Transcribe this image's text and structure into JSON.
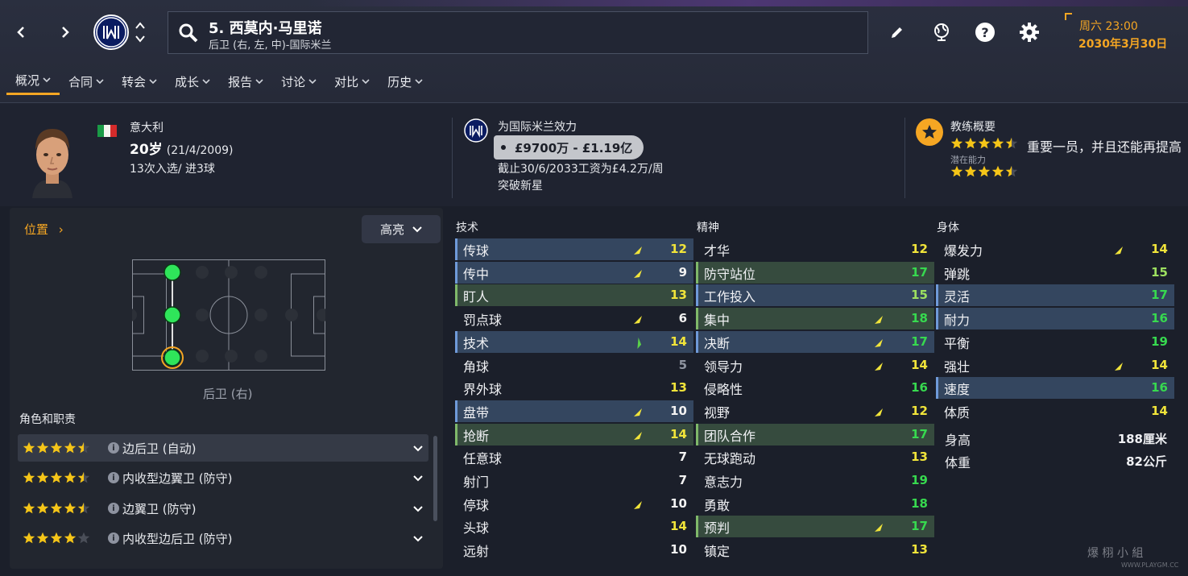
{
  "header": {
    "player_title": "5. 西莫内·马里诺",
    "player_position": "后卫 (右, 左, 中)-国际米兰",
    "club_badge_text": "M",
    "date_line1": "周六 23:00",
    "date_line2": "2030年3月30日"
  },
  "tabs": [
    {
      "label": "概况",
      "active": true
    },
    {
      "label": "合同"
    },
    {
      "label": "转会"
    },
    {
      "label": "成长"
    },
    {
      "label": "报告"
    },
    {
      "label": "讨论"
    },
    {
      "label": "对比"
    },
    {
      "label": "历史"
    }
  ],
  "profile": {
    "nationality": "意大利",
    "age": "20岁",
    "birthdate": "(21/4/2009)",
    "caps": "13次入选/ 进3球",
    "club_line": "为国际米兰效力",
    "value_range": "£9700万 - £1.19亿",
    "contract": "截止30/6/2033工资为£4.2万/周",
    "status": "突破新星",
    "coach_title": "教练概要",
    "coach_summary": "重要一员，并且还能再提高",
    "potential_label": "潜在能力",
    "current_stars": 4.5,
    "potential_stars": 4.5
  },
  "left_panel": {
    "position_link": "位置",
    "highlight_button": "高亮",
    "position_label": "后卫 (右)",
    "roles_title": "角色和职责",
    "roles": [
      {
        "stars": 4.5,
        "label": "边后卫 (自动)"
      },
      {
        "stars": 4.5,
        "label": "内收型边翼卫 (防守)"
      },
      {
        "stars": 4.5,
        "label": "边翼卫 (防守)"
      },
      {
        "stars": 4.0,
        "label": "内收型边后卫 (防守)"
      }
    ]
  },
  "columns": {
    "technical": {
      "title": "技术",
      "attrs": [
        {
          "name": "传球",
          "value": "12",
          "color": "yellow",
          "hl": "blue",
          "arrow": "up"
        },
        {
          "name": "传中",
          "value": "9",
          "color": "white",
          "hl": "blue",
          "arrow": "up"
        },
        {
          "name": "盯人",
          "value": "13",
          "color": "yellow",
          "hl": "green",
          "arrow": ""
        },
        {
          "name": "罚点球",
          "value": "6",
          "color": "white",
          "hl": "",
          "arrow": "up"
        },
        {
          "name": "技术",
          "value": "14",
          "color": "yellow",
          "hl": "blue",
          "arrow": "upg"
        },
        {
          "name": "角球",
          "value": "5",
          "color": "grey",
          "hl": "",
          "arrow": ""
        },
        {
          "name": "界外球",
          "value": "13",
          "color": "yellow",
          "hl": "",
          "arrow": ""
        },
        {
          "name": "盘带",
          "value": "10",
          "color": "white",
          "hl": "blue",
          "arrow": "up"
        },
        {
          "name": "抢断",
          "value": "14",
          "color": "yellow",
          "hl": "green",
          "arrow": "up"
        },
        {
          "name": "任意球",
          "value": "7",
          "color": "white",
          "hl": "",
          "arrow": ""
        },
        {
          "name": "射门",
          "value": "7",
          "color": "white",
          "hl": "",
          "arrow": ""
        },
        {
          "name": "停球",
          "value": "10",
          "color": "white",
          "hl": "",
          "arrow": "up"
        },
        {
          "name": "头球",
          "value": "14",
          "color": "yellow",
          "hl": "",
          "arrow": ""
        },
        {
          "name": "远射",
          "value": "10",
          "color": "white",
          "hl": "",
          "arrow": ""
        }
      ]
    },
    "mental": {
      "title": "精神",
      "attrs": [
        {
          "name": "才华",
          "value": "12",
          "color": "yellow",
          "hl": "",
          "arrow": ""
        },
        {
          "name": "防守站位",
          "value": "17",
          "color": "green",
          "hl": "green",
          "arrow": ""
        },
        {
          "name": "工作投入",
          "value": "15",
          "color": "lgreen",
          "hl": "blue",
          "arrow": ""
        },
        {
          "name": "集中",
          "value": "18",
          "color": "green",
          "hl": "green",
          "arrow": "up"
        },
        {
          "name": "决断",
          "value": "17",
          "color": "green",
          "hl": "blue",
          "arrow": "up"
        },
        {
          "name": "领导力",
          "value": "14",
          "color": "yellow",
          "hl": "",
          "arrow": "up"
        },
        {
          "name": "侵略性",
          "value": "16",
          "color": "green",
          "hl": "",
          "arrow": ""
        },
        {
          "name": "视野",
          "value": "12",
          "color": "yellow",
          "hl": "",
          "arrow": "up"
        },
        {
          "name": "团队合作",
          "value": "17",
          "color": "green",
          "hl": "green",
          "arrow": ""
        },
        {
          "name": "无球跑动",
          "value": "13",
          "color": "yellow",
          "hl": "",
          "arrow": ""
        },
        {
          "name": "意志力",
          "value": "19",
          "color": "green",
          "hl": "",
          "arrow": ""
        },
        {
          "name": "勇敢",
          "value": "18",
          "color": "green",
          "hl": "",
          "arrow": ""
        },
        {
          "name": "预判",
          "value": "17",
          "color": "green",
          "hl": "green",
          "arrow": "up"
        },
        {
          "name": "镇定",
          "value": "13",
          "color": "yellow",
          "hl": "",
          "arrow": ""
        }
      ]
    },
    "physical": {
      "title": "身体",
      "attrs": [
        {
          "name": "爆发力",
          "value": "14",
          "color": "yellow",
          "hl": "",
          "arrow": "up"
        },
        {
          "name": "弹跳",
          "value": "15",
          "color": "lgreen",
          "hl": "",
          "arrow": ""
        },
        {
          "name": "灵活",
          "value": "17",
          "color": "green",
          "hl": "blue",
          "arrow": ""
        },
        {
          "name": "耐力",
          "value": "16",
          "color": "green",
          "hl": "blue",
          "arrow": ""
        },
        {
          "name": "平衡",
          "value": "19",
          "color": "green",
          "hl": "",
          "arrow": ""
        },
        {
          "name": "强壮",
          "value": "14",
          "color": "yellow",
          "hl": "",
          "arrow": "up"
        },
        {
          "name": "速度",
          "value": "16",
          "color": "green",
          "hl": "blue",
          "arrow": ""
        },
        {
          "name": "体质",
          "value": "14",
          "color": "yellow",
          "hl": "",
          "arrow": ""
        }
      ],
      "height_label": "身高",
      "height_value": "188厘米",
      "weight_label": "体重",
      "weight_value": "82公斤"
    }
  },
  "watermark": {
    "line1": "爆 栩 小 組",
    "line2": "WWW.PLAYGM.CC"
  },
  "colors": {
    "accent": "#f5a623",
    "highlight_blue": "#34465f",
    "highlight_green": "#364b3e",
    "value_green": "#37d94f",
    "value_yellow": "#f1e43a"
  }
}
